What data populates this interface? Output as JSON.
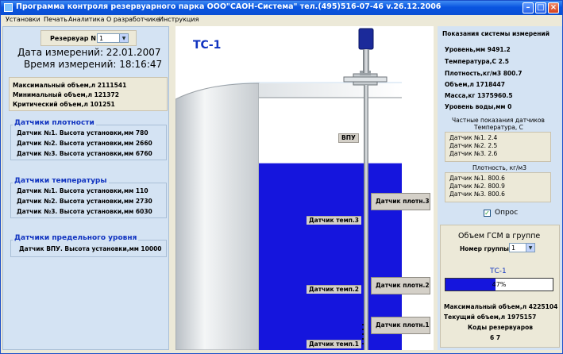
{
  "window": {
    "title": "Программа контроля резервуарного парка ООО\"САОН-Система\" тел.(495)516-07-46 v.26.12.2006",
    "icons": [
      "minimize-icon",
      "maximize-icon",
      "close-icon"
    ]
  },
  "menu": [
    "Установки",
    "Печать",
    "Аналитика",
    "О разработчике",
    "Инструкция"
  ],
  "left": {
    "tank_select_label": "Резервуар N",
    "tank_select_value": "1",
    "date_text": "Дата измерений: 22.01.2007",
    "time_text": "Время измерений: 18:16:47",
    "volumes": [
      "Максимальный объем,л 2111541",
      "Минимальный объем,л 121372",
      "Критический объем,л 101251"
    ],
    "density_group": {
      "title": "Датчики плотности",
      "items": [
        "Датчик №1. Высота установки,мм 780",
        "Датчик №2. Высота установки,мм 2660",
        "Датчик №3. Высота установки,мм 6760"
      ]
    },
    "temp_group": {
      "title": "Датчики температуры",
      "items": [
        "Датчик №1. Высота установки,мм 110",
        "Датчик №2. Высота установки,мм 2730",
        "Датчик №3. Высота установки,мм 6030"
      ]
    },
    "limit_group": {
      "title": "Датчики предельного уровня",
      "items": [
        "Датчик ВПУ. Высота установки,мм 10000"
      ]
    }
  },
  "tank": {
    "label": "ТС-1",
    "fill_fraction": 0.74,
    "vpu_label": "ВПУ",
    "density_sensors": [
      "Датчик плотн.3",
      "Датчик плотн.2",
      "Датчик плотн.1"
    ],
    "temp_sensors": [
      "Датчик темп.3",
      "Датчик темп.2",
      "Датчик темп.1"
    ]
  },
  "right": {
    "header": "Показания системы измерений",
    "readings": [
      "Уровень,мм 9491.2",
      "Температура,С 2.5",
      "Плотность,кг/м3 800.7",
      "Объем,л 1718447",
      "Масса,кг 1375960.5",
      "Уровень воды,мм 0"
    ],
    "partial_header": "Частные показания датчиков",
    "temp_header": "Температура, С",
    "temps": [
      "Датчик №1. 2.4",
      "Датчик №2. 2.5",
      "Датчик №3. 2.6"
    ],
    "density_header": "Плотность, кг/м3",
    "densities": [
      "Датчик №1. 800.6",
      "Датчик №2. 800.9",
      "Датчик №3. 800.6"
    ],
    "poll_label": "Опрос",
    "poll_checked": true,
    "group_title": "Объем ГСМ в группе",
    "group_number_label": "Номер группы",
    "group_number_value": "1",
    "group_tank": "ТС-1",
    "group_progress_percent": 47,
    "group_progress_label": "47%",
    "group_max": "Максимальный объем,л 4225104",
    "group_current": "Текущий объем,л 1975157",
    "codes_label": "Коды резервуаров",
    "codes_value": "6 7"
  },
  "colors": {
    "accent_blue": "#1033c0",
    "fluid_blue": "#1515dd",
    "panel_bg": "#d4e3f3"
  }
}
